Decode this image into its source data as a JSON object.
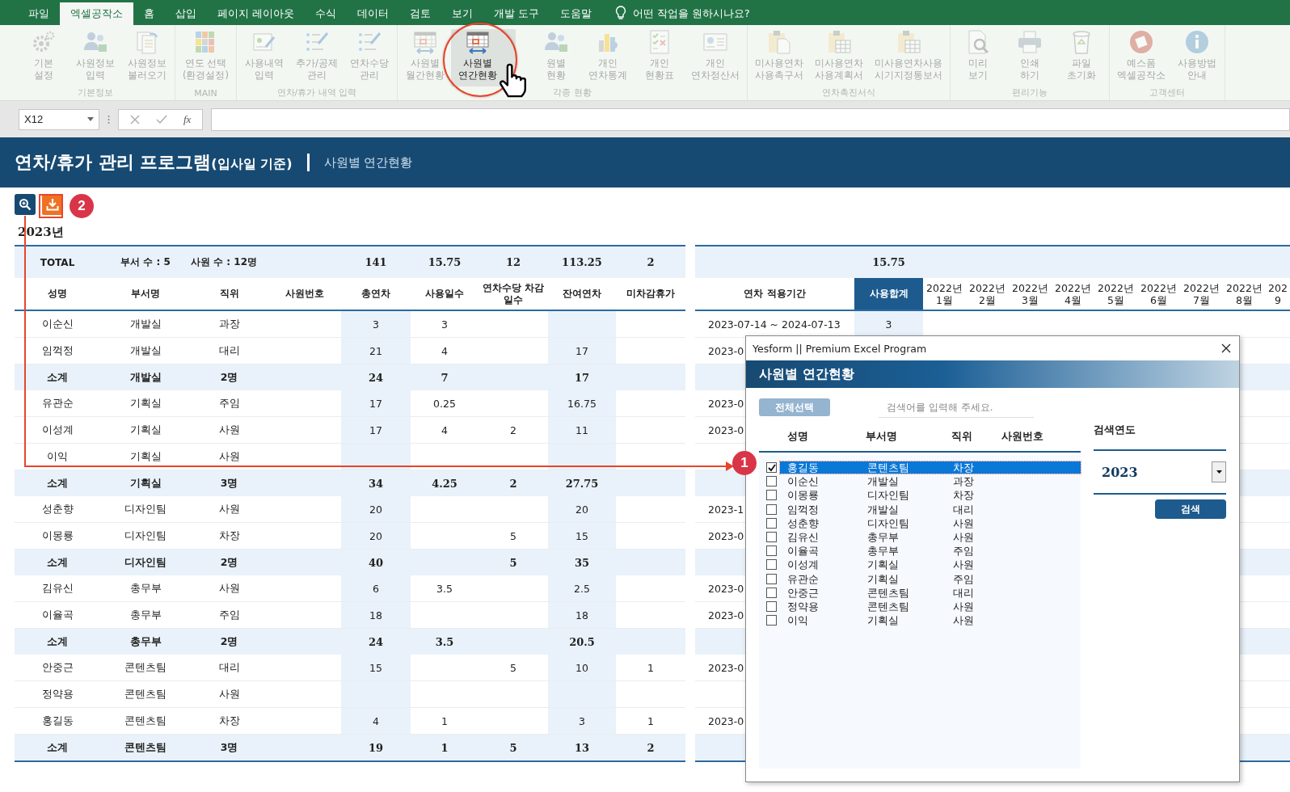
{
  "menu_tabs": [
    {
      "label": "파일",
      "selected": false
    },
    {
      "label": "엑셀공작소",
      "selected": true
    },
    {
      "label": "홈",
      "selected": false
    },
    {
      "label": "삽입",
      "selected": false
    },
    {
      "label": "페이지 레이아웃",
      "selected": false
    },
    {
      "label": "수식",
      "selected": false
    },
    {
      "label": "데이터",
      "selected": false
    },
    {
      "label": "검토",
      "selected": false
    },
    {
      "label": "보기",
      "selected": false
    },
    {
      "label": "개발 도구",
      "selected": false
    },
    {
      "label": "도움말",
      "selected": false
    }
  ],
  "tell_me": "어떤 작업을 원하시나요?",
  "ribbon_groups": [
    {
      "label": "기본정보",
      "buttons": [
        {
          "lines": [
            "기본",
            "설정"
          ],
          "disabled": true
        },
        {
          "lines": [
            "사원정보",
            "입력"
          ],
          "disabled": true
        },
        {
          "lines": [
            "사원정보",
            "불러오기"
          ],
          "disabled": true
        }
      ]
    },
    {
      "label": "MAIN",
      "buttons": [
        {
          "lines": [
            "연도 선택",
            "(환경설정)"
          ],
          "disabled": true
        }
      ]
    },
    {
      "label": "연차/휴가 내역 입력",
      "buttons": [
        {
          "lines": [
            "사용내역",
            "입력"
          ],
          "disabled": true
        },
        {
          "lines": [
            "추가/공제",
            "관리"
          ],
          "disabled": true
        },
        {
          "lines": [
            "연차수당",
            "관리"
          ],
          "disabled": true
        }
      ]
    },
    {
      "label": "각종 현황",
      "buttons": [
        {
          "lines": [
            "사원별",
            "월간현황"
          ],
          "disabled": true
        },
        {
          "lines": [
            "사원별",
            "연간현황"
          ],
          "disabled": false
        },
        {
          "lines": [
            "원별",
            "현황"
          ],
          "disabled": true
        },
        {
          "lines": [
            "개인",
            "연차통계"
          ],
          "disabled": true
        },
        {
          "lines": [
            "개인",
            "현황표"
          ],
          "disabled": true
        },
        {
          "lines": [
            "개인",
            "연차정산서"
          ],
          "disabled": true
        }
      ]
    },
    {
      "label": "연차촉진서식",
      "buttons": [
        {
          "lines": [
            "미사용연차",
            "사용촉구서"
          ],
          "disabled": true
        },
        {
          "lines": [
            "미사용연차",
            "사용계획서"
          ],
          "disabled": true
        },
        {
          "lines": [
            "미사용연차사용",
            "시기지정통보서"
          ],
          "disabled": true
        }
      ]
    },
    {
      "label": "편리기능",
      "buttons": [
        {
          "lines": [
            "미리",
            "보기"
          ],
          "disabled": true
        },
        {
          "lines": [
            "인쇄",
            "하기"
          ],
          "disabled": true
        },
        {
          "lines": [
            "파일",
            "초기화"
          ],
          "disabled": true
        }
      ]
    },
    {
      "label": "고객센터",
      "buttons": [
        {
          "lines": [
            "예스폼",
            "엑셀공작소"
          ],
          "disabled": true
        },
        {
          "lines": [
            "사용방법",
            "안내"
          ],
          "disabled": true
        }
      ]
    }
  ],
  "formula_bar": {
    "name_box": "X12",
    "fx": "fx"
  },
  "header": {
    "title": "연차/휴가 관리 프로그램",
    "title_note": "(입사일 기준)",
    "subtitle": "사원별 연간현황"
  },
  "badges": [
    "2",
    "1"
  ],
  "year_label": "2023년",
  "table": {
    "columns": [
      "성명",
      "부서명",
      "직위",
      "사원번호",
      "총연차",
      "사용일수",
      "연차수당 차감일수",
      "잔여연차",
      "미차감휴가"
    ],
    "right_columns": {
      "period": "연차 적용기간",
      "sum": "사용합계",
      "months": [
        "2022년 1월",
        "2022년 2월",
        "2022년 3월",
        "2022년 4월",
        "2022년 5월",
        "2022년 6월",
        "2022년 7월",
        "2022년 8월",
        "202 9"
      ]
    },
    "total": {
      "label": "TOTAL",
      "departments": "부서 수 : 5",
      "employees": "사원 수 : 12명",
      "total": "141",
      "used": "15.75",
      "allowance": "12",
      "remain": "113.25",
      "extra": "2",
      "sum": "15.75"
    },
    "rows": [
      {
        "kind": "employee",
        "name": "이순신",
        "dept": "개발실",
        "position": "과장",
        "total": "3",
        "used": "3",
        "period": "2023-07-14 ~ 2024-07-13",
        "sum": "3"
      },
      {
        "kind": "employee",
        "name": "임꺽정",
        "dept": "개발실",
        "position": "대리",
        "total": "21",
        "used": "4",
        "remain": "17",
        "period": "2023-0"
      },
      {
        "kind": "subtotal",
        "name": "소계",
        "dept": "개발실",
        "position": "2명",
        "total": "24",
        "used": "7",
        "remain": "17"
      },
      {
        "kind": "employee",
        "name": "유관순",
        "dept": "기획실",
        "position": "주임",
        "total": "17",
        "used": "0.25",
        "remain": "16.75",
        "period": "2023-0"
      },
      {
        "kind": "employee",
        "name": "이성계",
        "dept": "기획실",
        "position": "사원",
        "total": "17",
        "used": "4",
        "allowance": "2",
        "remain": "11",
        "period": "2023-0"
      },
      {
        "kind": "employee",
        "name": "이익",
        "dept": "기획실",
        "position": "사원"
      },
      {
        "kind": "subtotal",
        "name": "소계",
        "dept": "기획실",
        "position": "3명",
        "total": "34",
        "used": "4.25",
        "allowance": "2",
        "remain": "27.75"
      },
      {
        "kind": "employee",
        "name": "성춘향",
        "dept": "디자인팀",
        "position": "사원",
        "total": "20",
        "remain": "20",
        "period": "2023-1"
      },
      {
        "kind": "employee",
        "name": "이몽룡",
        "dept": "디자인팀",
        "position": "차장",
        "total": "20",
        "allowance": "5",
        "remain": "15",
        "period": "2023-0"
      },
      {
        "kind": "subtotal",
        "name": "소계",
        "dept": "디자인팀",
        "position": "2명",
        "total": "40",
        "allowance": "5",
        "remain": "35"
      },
      {
        "kind": "employee",
        "name": "김유신",
        "dept": "총무부",
        "position": "사원",
        "total": "6",
        "used": "3.5",
        "remain": "2.5",
        "period": "2023-0"
      },
      {
        "kind": "employee",
        "name": "이율곡",
        "dept": "총무부",
        "position": "주임",
        "total": "18",
        "remain": "18",
        "period": "2023-0"
      },
      {
        "kind": "subtotal",
        "name": "소계",
        "dept": "총무부",
        "position": "2명",
        "total": "24",
        "used": "3.5",
        "remain": "20.5"
      },
      {
        "kind": "employee",
        "name": "안중근",
        "dept": "콘텐츠팀",
        "position": "대리",
        "total": "15",
        "allowance": "5",
        "remain": "10",
        "extra": "1",
        "period": "2023-0"
      },
      {
        "kind": "employee",
        "name": "정약용",
        "dept": "콘텐츠팀",
        "position": "사원"
      },
      {
        "kind": "employee",
        "name": "홍길동",
        "dept": "콘텐츠팀",
        "position": "차장",
        "total": "4",
        "used": "1",
        "remain": "3",
        "extra": "1",
        "period": "2023-0"
      },
      {
        "kind": "subtotal",
        "name": "소계",
        "dept": "콘텐츠팀",
        "position": "3명",
        "total": "19",
        "used": "1",
        "allowance": "5",
        "remain": "13",
        "extra": "2"
      }
    ]
  },
  "dialog": {
    "title": "Yesform  ||  Premium Excel Program",
    "heading": "사원별 연간현황",
    "select_all": "전체선택",
    "search_placeholder": "검색어를 입력해 주세요.",
    "columns": [
      "성명",
      "부서명",
      "직위",
      "사원번호"
    ],
    "employees": [
      {
        "name": "홍길동",
        "dept": "콘텐츠팀",
        "position": "차장",
        "checked": true,
        "selected": true
      },
      {
        "name": "이순신",
        "dept": "개발실",
        "position": "과장",
        "checked": false,
        "selected": false
      },
      {
        "name": "이몽룡",
        "dept": "디자인팀",
        "position": "차장",
        "checked": false,
        "selected": false
      },
      {
        "name": "임꺽정",
        "dept": "개발실",
        "position": "대리",
        "checked": false,
        "selected": false
      },
      {
        "name": "성춘향",
        "dept": "디자인팀",
        "position": "사원",
        "checked": false,
        "selected": false
      },
      {
        "name": "김유신",
        "dept": "총무부",
        "position": "사원",
        "checked": false,
        "selected": false
      },
      {
        "name": "이율곡",
        "dept": "총무부",
        "position": "주임",
        "checked": false,
        "selected": false
      },
      {
        "name": "이성계",
        "dept": "기획실",
        "position": "사원",
        "checked": false,
        "selected": false
      },
      {
        "name": "유관순",
        "dept": "기획실",
        "position": "주임",
        "checked": false,
        "selected": false
      },
      {
        "name": "안중근",
        "dept": "콘텐츠팀",
        "position": "대리",
        "checked": false,
        "selected": false
      },
      {
        "name": "정약용",
        "dept": "콘텐츠팀",
        "position": "사원",
        "checked": false,
        "selected": false
      },
      {
        "name": "이익",
        "dept": "기획실",
        "position": "사원",
        "checked": false,
        "selected": false
      }
    ],
    "year_label": "검색연도",
    "year": "2023",
    "search_button": "검색"
  }
}
